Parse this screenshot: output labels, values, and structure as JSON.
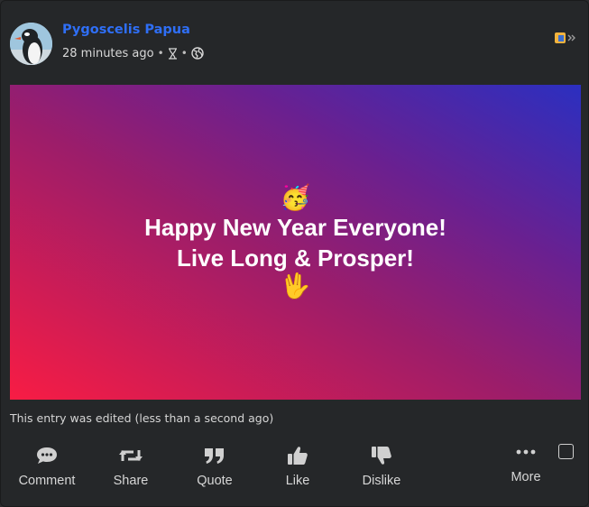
{
  "post": {
    "author": "Pygoscelis Papua",
    "timestamp": "28 minutes ago",
    "meta_separator": "•",
    "meta_icons": [
      "hourglass-icon",
      "globe-icon"
    ],
    "corner_icon": "app-switch-icon",
    "hero": {
      "emoji_top": "🥳",
      "line1": "Happy New Year Everyone!",
      "line2": "Live Long & Prosper!",
      "emoji_bottom": "🖖"
    },
    "edited_note": "This entry was edited (less than a second ago)"
  },
  "actions": [
    {
      "label": "Comment",
      "icon": "comment-icon"
    },
    {
      "label": "Share",
      "icon": "share-icon"
    },
    {
      "label": "Quote",
      "icon": "quote-icon"
    },
    {
      "label": "Like",
      "icon": "thumbs-up-icon"
    },
    {
      "label": "Dislike",
      "icon": "thumbs-down-icon"
    },
    {
      "label": "More",
      "icon": "more-icon"
    }
  ],
  "colors": {
    "background": "#252729",
    "author_link": "#2f6ff6",
    "text": "#d6d6d6",
    "hero_gradient_start": "#f81c44",
    "hero_gradient_end": "#2b2fc0"
  }
}
